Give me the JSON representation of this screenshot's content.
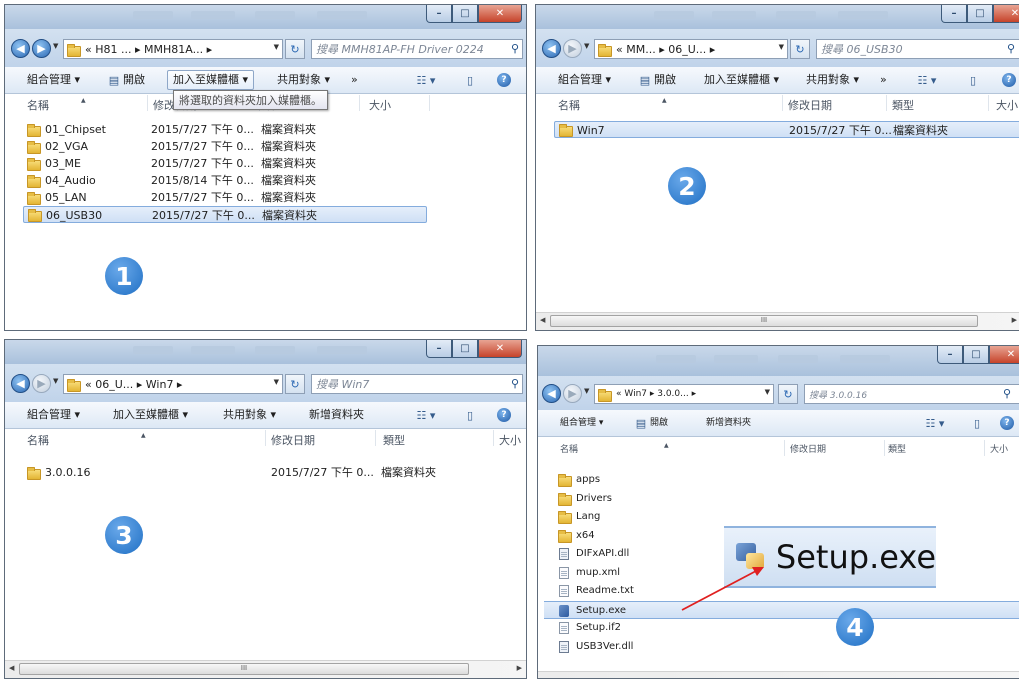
{
  "columns": {
    "name": "名稱",
    "date": "修改日期",
    "type": "類型",
    "size": "大小"
  },
  "panel1": {
    "step": "1",
    "address": "« H81 ... ▸ MMH81A... ▸",
    "search_placeholder": "搜尋 MMH81AP-FH Driver 0224",
    "toolbar": {
      "organize": "組合管理 ▾",
      "open": "開啟",
      "add_library": "加入至媒體櫃 ▾",
      "share": "共用對象 ▾",
      "more": "»"
    },
    "tooltip": "將選取的資料夾加入媒體櫃。",
    "rows": [
      {
        "name": "01_Chipset",
        "date": "2015/7/27 下午 0...",
        "type": "檔案資料夾"
      },
      {
        "name": "02_VGA",
        "date": "2015/7/27 下午 0...",
        "type": "檔案資料夾"
      },
      {
        "name": "03_ME",
        "date": "2015/7/27 下午 0...",
        "type": "檔案資料夾"
      },
      {
        "name": "04_Audio",
        "date": "2015/8/14 下午 0...",
        "type": "檔案資料夾"
      },
      {
        "name": "05_LAN",
        "date": "2015/7/27 下午 0...",
        "type": "檔案資料夾"
      },
      {
        "name": "06_USB30",
        "date": "2015/7/27 下午 0...",
        "type": "檔案資料夾"
      }
    ]
  },
  "panel2": {
    "step": "2",
    "address": "« MM... ▸ 06_U... ▸",
    "search_placeholder": "搜尋 06_USB30",
    "toolbar": {
      "organize": "組合管理 ▾",
      "open": "開啟",
      "add_library": "加入至媒體櫃 ▾",
      "share": "共用對象 ▾",
      "more": "»"
    },
    "rows": [
      {
        "name": "Win7",
        "date": "2015/7/27 下午 0...",
        "type": "檔案資料夾"
      }
    ],
    "scroll_grip": "III"
  },
  "panel3": {
    "step": "3",
    "address": "« 06_U... ▸ Win7 ▸",
    "search_placeholder": "搜尋 Win7",
    "toolbar": {
      "organize": "組合管理 ▾",
      "add_library": "加入至媒體櫃 ▾",
      "share": "共用對象 ▾",
      "new_folder": "新增資料夾"
    },
    "rows": [
      {
        "name": "3.0.0.16",
        "date": "2015/7/27 下午 0...",
        "type": "檔案資料夾"
      }
    ],
    "scroll_grip": "III"
  },
  "panel4": {
    "step": "4",
    "address": "« Win7 ▸ 3.0.0... ▸",
    "search_placeholder": "搜尋 3.0.0.16",
    "toolbar": {
      "organize": "組合管理 ▾",
      "open": "開啟",
      "new_folder": "新增資料夾"
    },
    "rows": [
      {
        "name": "apps",
        "kind": "folder"
      },
      {
        "name": "Drivers",
        "kind": "folder"
      },
      {
        "name": "Lang",
        "kind": "folder"
      },
      {
        "name": "x64",
        "kind": "folder"
      },
      {
        "name": "DIFxAPI.dll",
        "kind": "dll"
      },
      {
        "name": "mup.xml",
        "kind": "xml"
      },
      {
        "name": "Readme.txt",
        "kind": "txt"
      },
      {
        "name": "Setup.exe",
        "kind": "exe"
      },
      {
        "name": "Setup.if2",
        "kind": "file"
      },
      {
        "name": "USB3Ver.dll",
        "kind": "dll"
      }
    ],
    "zoom_label": "Setup.exe"
  },
  "colors": {
    "accent": "#1f6fc4",
    "selection": "#cfe0f5",
    "arrow": "#e02020"
  }
}
